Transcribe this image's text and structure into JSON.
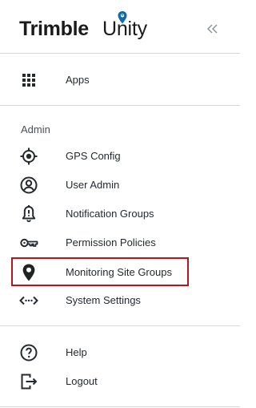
{
  "header": {
    "brand_bold": "Trimble",
    "brand_light": "Unity",
    "collapse_glyph": "«"
  },
  "nav_top": [
    {
      "label": "Apps",
      "icon": "apps-grid-icon"
    }
  ],
  "admin": {
    "section_label": "Admin",
    "items": [
      {
        "label": "GPS Config",
        "icon": "gps-target-icon"
      },
      {
        "label": "User Admin",
        "icon": "user-circle-icon"
      },
      {
        "label": "Notification Groups",
        "icon": "bell-alert-icon"
      },
      {
        "label": "Permission Policies",
        "icon": "key-icon"
      },
      {
        "label": "Monitoring Site Groups",
        "icon": "location-pin-icon",
        "highlighted": true
      },
      {
        "label": "System Settings",
        "icon": "code-dots-icon"
      }
    ]
  },
  "nav_bottom": [
    {
      "label": "Help",
      "icon": "help-circle-icon"
    },
    {
      "label": "Logout",
      "icon": "logout-icon"
    }
  ],
  "colors": {
    "highlight_border": "#b0171f",
    "brand_pin": "#0e6aa8",
    "divider": "#d8d8d8"
  }
}
